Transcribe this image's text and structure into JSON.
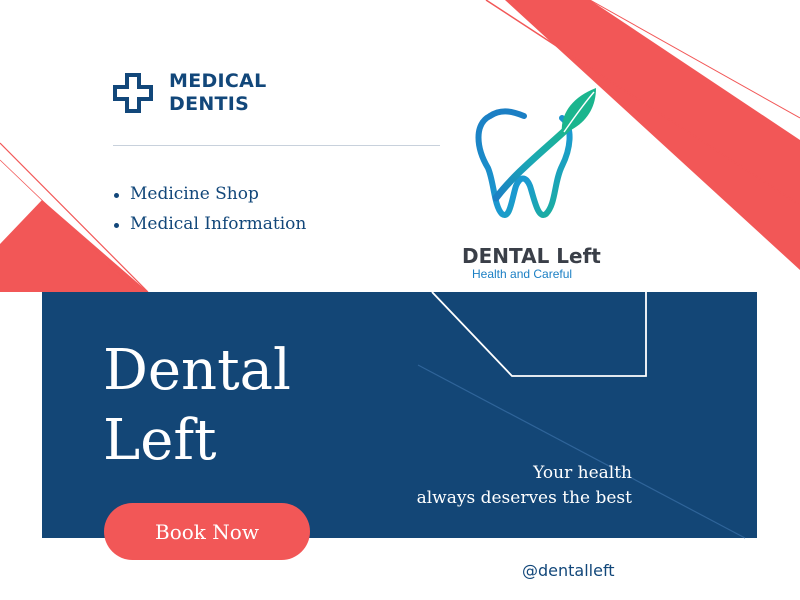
{
  "brand": {
    "line1": "MEDICAL",
    "line2": "DENTIS",
    "icon": "medical-cross-icon"
  },
  "nav": {
    "items": [
      {
        "label": "Medicine Shop"
      },
      {
        "label": "Medical Information"
      }
    ]
  },
  "logo": {
    "title": "DENTAL Left",
    "tagline": "Health and Careful",
    "icon": "tooth-leaf-logo-icon"
  },
  "hero": {
    "title_line1": "Dental",
    "title_line2": "Left"
  },
  "tagline": {
    "line1": "Your health",
    "line2": "always deserves the best"
  },
  "cta": {
    "label": "Book Now"
  },
  "social": {
    "handle": "@dentalleft"
  },
  "colors": {
    "navy": "#134676",
    "coral": "#f25757",
    "white": "#ffffff",
    "logo_blue": "#1b7fc4",
    "logo_green": "#1bb58e"
  }
}
